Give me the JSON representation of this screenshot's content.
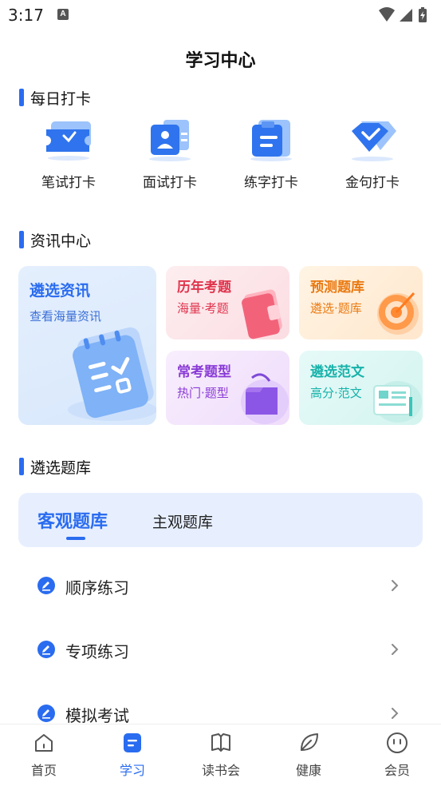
{
  "status_bar": {
    "time": "3:17",
    "notification_badge": "A",
    "icons": [
      "wifi-icon",
      "signal-icon",
      "battery-icon"
    ]
  },
  "header": {
    "title": "学习中心"
  },
  "daily_checkin": {
    "title": "每日打卡",
    "items": [
      {
        "label": "笔试打卡",
        "icon": "ticket-icon"
      },
      {
        "label": "面试打卡",
        "icon": "id-card-icon"
      },
      {
        "label": "练字打卡",
        "icon": "clipboard-icon"
      },
      {
        "label": "金句打卡",
        "icon": "diamond-icon"
      }
    ]
  },
  "news_center": {
    "title": "资讯中心",
    "cards": [
      {
        "title": "遴选资讯",
        "subtitle": "查看海量资讯",
        "icon": "notebook-icon"
      },
      {
        "title": "历年考题",
        "subtitle": "海量·考题",
        "icon": "wallet-icon"
      },
      {
        "title": "预测题库",
        "subtitle": "遴选·题库",
        "icon": "target-icon"
      },
      {
        "title": "常考题型",
        "subtitle": "热门·题型",
        "icon": "folder-icon"
      },
      {
        "title": "遴选范文",
        "subtitle": "高分·范文",
        "icon": "document-icon"
      }
    ]
  },
  "question_bank": {
    "title": "遴选题库",
    "tabs": [
      {
        "label": "客观题库",
        "active": true
      },
      {
        "label": "主观题库",
        "active": false
      }
    ],
    "practice_items": [
      {
        "label": "顺序练习"
      },
      {
        "label": "专项练习"
      },
      {
        "label": "模拟考试"
      }
    ]
  },
  "bottom_nav": {
    "items": [
      {
        "label": "首页",
        "icon": "home-icon",
        "active": false
      },
      {
        "label": "学习",
        "icon": "study-icon",
        "active": true
      },
      {
        "label": "读书会",
        "icon": "book-icon",
        "active": false
      },
      {
        "label": "健康",
        "icon": "leaf-icon",
        "active": false
      },
      {
        "label": "会员",
        "icon": "member-icon",
        "active": false
      }
    ]
  },
  "colors": {
    "accent": "#2a6cf0",
    "tab_background": "#e7efff",
    "card_blue": "#e6f0fd",
    "card_pink": "#fde9ec",
    "card_orange": "#fff1e0",
    "card_purple": "#f6eafd",
    "card_teal": "#e3f8f6"
  }
}
